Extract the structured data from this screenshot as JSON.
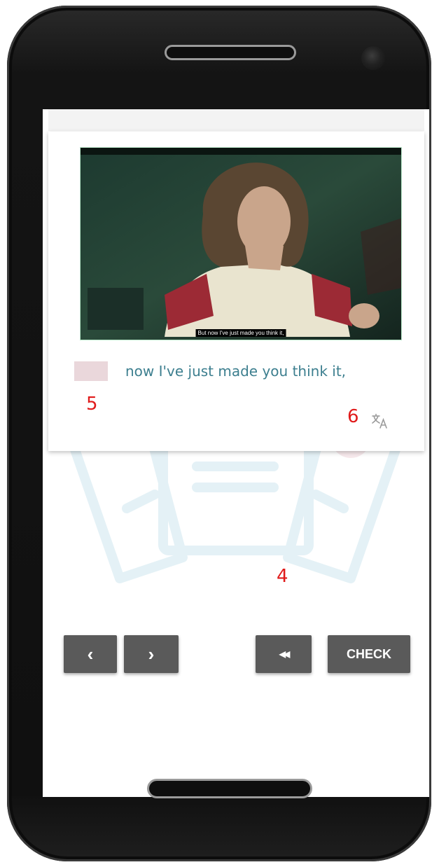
{
  "video": {
    "subtitle": "But now I've just made you think it,"
  },
  "exercise": {
    "sentence": "now I've just made you think it,",
    "blank_color": "#ead7db",
    "text_color": "#3d7f8f"
  },
  "annotations": {
    "blank_marker": "5",
    "translate_marker": "6",
    "rewind_marker": "4"
  },
  "icons": {
    "translate": "translate-icon",
    "prev": "chevron-left-icon",
    "next": "chevron-right-icon",
    "rewind": "rewind-icon"
  },
  "buttons": {
    "prev_label": "‹",
    "next_label": "›",
    "rewind_label": "◀◀",
    "check_label": "CHECK"
  },
  "colors": {
    "button_bg": "#5a5a5a",
    "annotation": "#e01a1a"
  }
}
